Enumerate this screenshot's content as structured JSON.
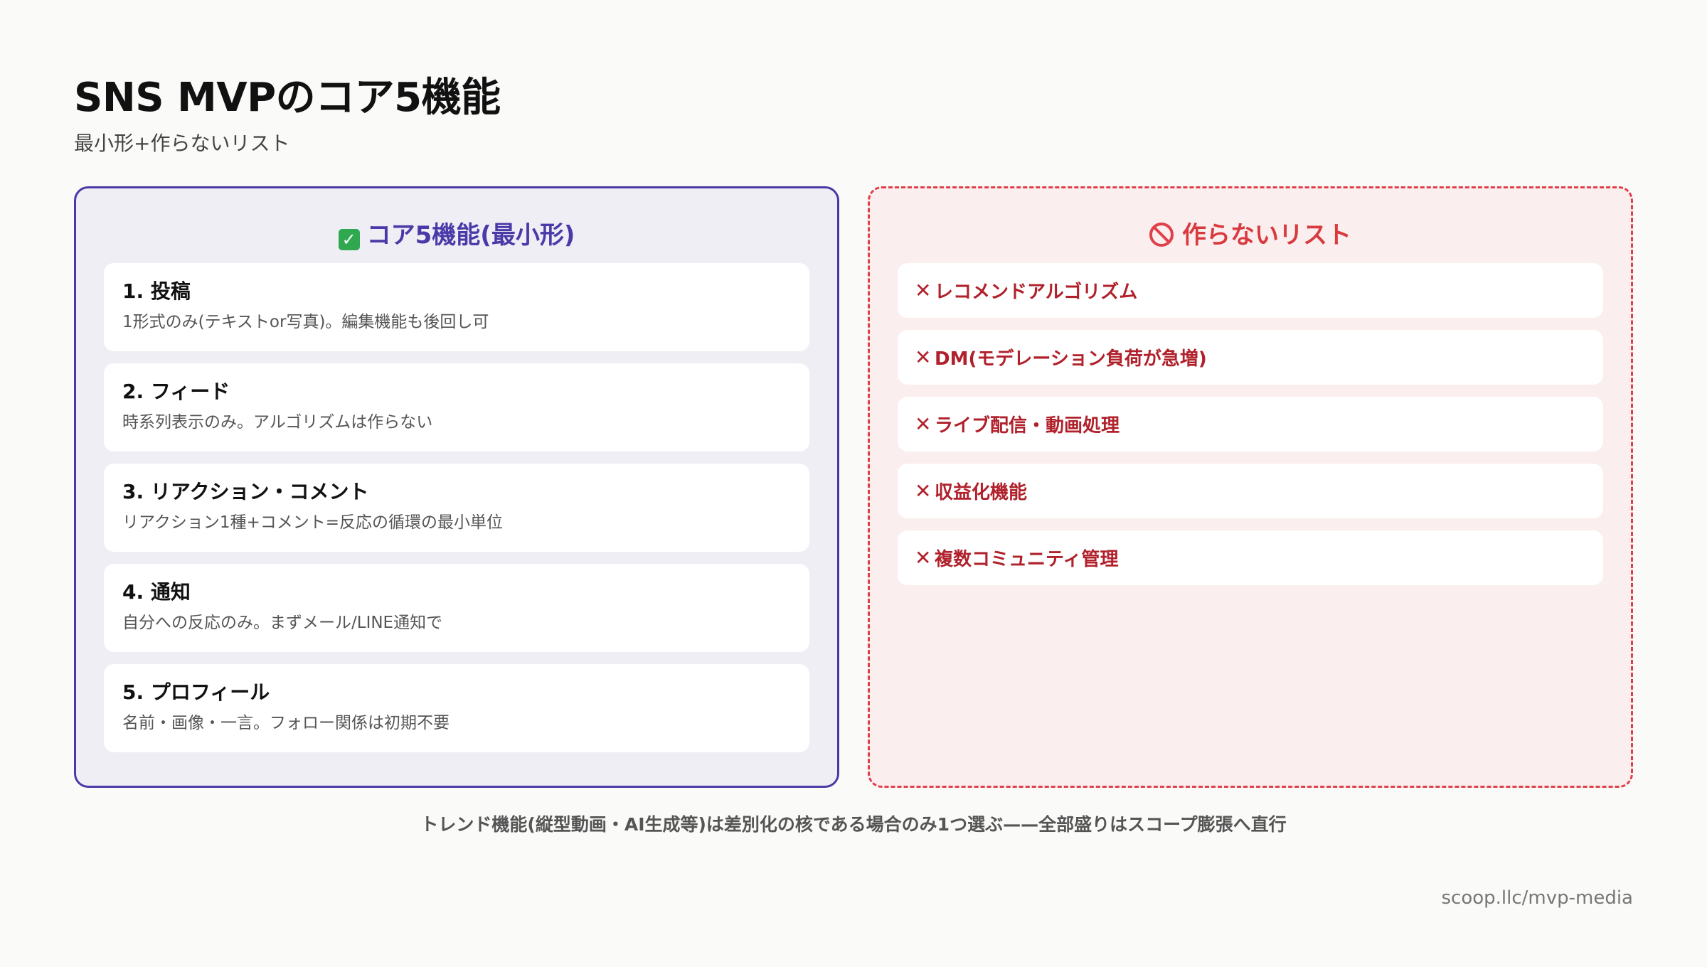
{
  "title": "SNS MVPのコア5機能",
  "subtitle": "最小形+作らないリスト",
  "core_panel": {
    "heading": "コア5機能(最小形)",
    "icon": "check-mark-icon",
    "items": [
      {
        "title": "1. 投稿",
        "desc": "1形式のみ(テキストor写真)。編集機能も後回し可"
      },
      {
        "title": "2. フィード",
        "desc": "時系列表示のみ。アルゴリズムは作らない"
      },
      {
        "title": "3. リアクション・コメント",
        "desc": "リアクション1種+コメント=反応の循環の最小単位"
      },
      {
        "title": "4. 通知",
        "desc": "自分への反応のみ。まずメール/LINE通知で"
      },
      {
        "title": "5. プロフィール",
        "desc": "名前・画像・一言。フォロー関係は初期不要"
      }
    ]
  },
  "dont_panel": {
    "heading": "作らないリスト",
    "icon": "prohibited-icon",
    "items": [
      "レコメンドアルゴリズム",
      "DM(モデレーション負荷が急増)",
      "ライブ配信・動画処理",
      "収益化機能",
      "複数コミュニティ管理"
    ]
  },
  "footnote": "トレンド機能(縦型動画・AI生成等)は差別化の核である場合のみ1つ選ぶ——全部盛りはスコープ膨張へ直行",
  "footer_url": "scoop.llc/mvp-media",
  "colors": {
    "core_accent": "#4a3aa8",
    "dont_accent": "#e0404a",
    "dont_text": "#b0212b",
    "check_green": "#2fa84f"
  }
}
